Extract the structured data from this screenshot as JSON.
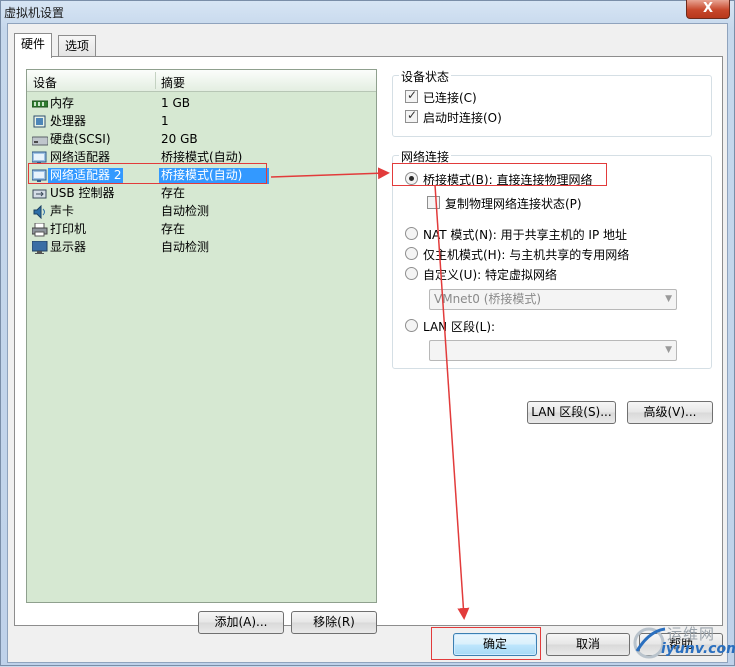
{
  "window": {
    "title": "虚拟机设置",
    "close_label": "X"
  },
  "tabs": [
    {
      "label": "硬件",
      "active": true
    },
    {
      "label": "选项",
      "active": false
    }
  ],
  "device_list": {
    "headers": {
      "device": "设备",
      "summary": "摘要"
    },
    "rows": [
      {
        "name": "内存",
        "summary": "1 GB",
        "icon": "memory-icon"
      },
      {
        "name": "处理器",
        "summary": "1",
        "icon": "processor-icon"
      },
      {
        "name": "硬盘(SCSI)",
        "summary": "20 GB",
        "icon": "hard-disk-icon"
      },
      {
        "name": "网络适配器",
        "summary": "桥接模式(自动)",
        "icon": "network-adapter-icon"
      },
      {
        "name": "网络适配器 2",
        "summary": "桥接模式(自动)",
        "icon": "network-adapter-icon",
        "selected": true
      },
      {
        "name": "USB 控制器",
        "summary": "存在",
        "icon": "usb-icon"
      },
      {
        "name": "声卡",
        "summary": "自动检测",
        "icon": "sound-card-icon"
      },
      {
        "name": "打印机",
        "summary": "存在",
        "icon": "printer-icon"
      },
      {
        "name": "显示器",
        "summary": "自动检测",
        "icon": "display-icon"
      }
    ]
  },
  "device_buttons": {
    "add": "添加(A)...",
    "remove": "移除(R)"
  },
  "device_status": {
    "title": "设备状态",
    "connected": {
      "label": "已连接(C)",
      "checked": true
    },
    "connect_at_power_on": {
      "label": "启动时连接(O)",
      "checked": true
    }
  },
  "network_connection": {
    "title": "网络连接",
    "bridged": {
      "label": "桥接模式(B): 直接连接物理网络",
      "selected": true
    },
    "replicate_state": {
      "label": "复制物理网络连接状态(P)",
      "checked": false
    },
    "nat": {
      "label": "NAT 模式(N): 用于共享主机的 IP 地址",
      "selected": false
    },
    "host_only": {
      "label": "仅主机模式(H): 与主机共享的专用网络",
      "selected": false
    },
    "custom": {
      "label": "自定义(U): 特定虚拟网络",
      "selected": false
    },
    "custom_combo_value": "VMnet0 (桥接模式)",
    "lan_segment": {
      "label": "LAN 区段(L):",
      "selected": false
    },
    "lan_combo_value": ""
  },
  "network_buttons": {
    "lan_segments": "LAN 区段(S)...",
    "advanced": "高级(V)..."
  },
  "footer_buttons": {
    "ok": "确定",
    "cancel": "取消",
    "help": "帮助"
  },
  "watermark": {
    "text_cn": "运维网",
    "text_url": "iyunv.com"
  },
  "colors": {
    "selection": "#3399ff",
    "list_background": "#d6e8d2",
    "annotation_red": "#e23b3b"
  }
}
